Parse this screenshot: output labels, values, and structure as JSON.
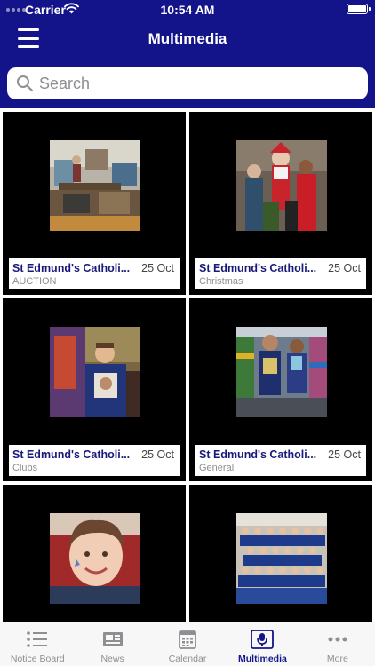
{
  "status_bar": {
    "carrier": "Carrier",
    "time": "10:54 AM"
  },
  "header": {
    "title": "Multimedia"
  },
  "search": {
    "placeholder": "Search"
  },
  "items": [
    {
      "title": "St Edmund's Catholi...",
      "date": "25 Oct",
      "category": "AUCTION",
      "photo": "auction-room-photo"
    },
    {
      "title": "St Edmund's Catholi...",
      "date": "25 Oct",
      "category": "Christmas",
      "photo": "christmas-group-photo"
    },
    {
      "title": "St Edmund's Catholi...",
      "date": "25 Oct",
      "category": "Clubs",
      "photo": "boy-with-artwork-photo"
    },
    {
      "title": "St Edmund's Catholi...",
      "date": "25 Oct",
      "category": "General",
      "photo": "children-in-library-photo"
    },
    {
      "title": "",
      "date": "",
      "category": "",
      "photo": "girl-face-paint-photo"
    },
    {
      "title": "",
      "date": "",
      "category": "",
      "photo": "class-group-photo"
    }
  ],
  "tabs": [
    {
      "label": "Notice Board",
      "icon": "list-icon"
    },
    {
      "label": "News",
      "icon": "newspaper-icon"
    },
    {
      "label": "Calendar",
      "icon": "calendar-icon"
    },
    {
      "label": "Multimedia",
      "icon": "microphone-icon",
      "active": true
    },
    {
      "label": "More",
      "icon": "more-dots-icon"
    }
  ],
  "colors": {
    "brand": "#14148a",
    "tile_bg": "#000000",
    "inactive": "#8e8e93"
  }
}
